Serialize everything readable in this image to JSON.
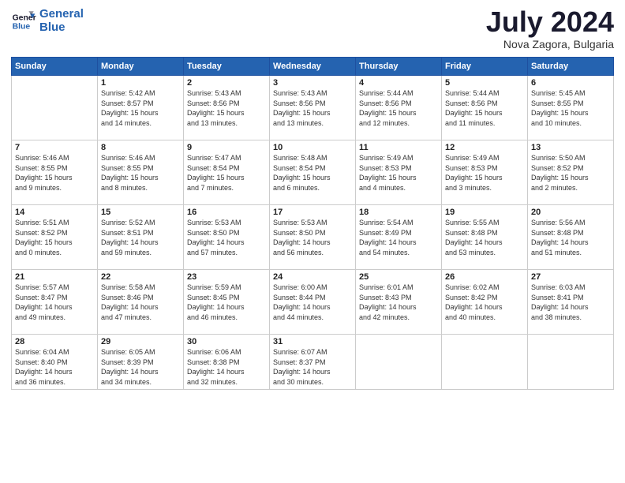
{
  "logo": {
    "line1": "General",
    "line2": "Blue"
  },
  "title": "July 2024",
  "location": "Nova Zagora, Bulgaria",
  "days_header": [
    "Sunday",
    "Monday",
    "Tuesday",
    "Wednesday",
    "Thursday",
    "Friday",
    "Saturday"
  ],
  "weeks": [
    [
      {
        "day": "",
        "info": ""
      },
      {
        "day": "1",
        "info": "Sunrise: 5:42 AM\nSunset: 8:57 PM\nDaylight: 15 hours\nand 14 minutes."
      },
      {
        "day": "2",
        "info": "Sunrise: 5:43 AM\nSunset: 8:56 PM\nDaylight: 15 hours\nand 13 minutes."
      },
      {
        "day": "3",
        "info": "Sunrise: 5:43 AM\nSunset: 8:56 PM\nDaylight: 15 hours\nand 13 minutes."
      },
      {
        "day": "4",
        "info": "Sunrise: 5:44 AM\nSunset: 8:56 PM\nDaylight: 15 hours\nand 12 minutes."
      },
      {
        "day": "5",
        "info": "Sunrise: 5:44 AM\nSunset: 8:56 PM\nDaylight: 15 hours\nand 11 minutes."
      },
      {
        "day": "6",
        "info": "Sunrise: 5:45 AM\nSunset: 8:55 PM\nDaylight: 15 hours\nand 10 minutes."
      }
    ],
    [
      {
        "day": "7",
        "info": "Sunrise: 5:46 AM\nSunset: 8:55 PM\nDaylight: 15 hours\nand 9 minutes."
      },
      {
        "day": "8",
        "info": "Sunrise: 5:46 AM\nSunset: 8:55 PM\nDaylight: 15 hours\nand 8 minutes."
      },
      {
        "day": "9",
        "info": "Sunrise: 5:47 AM\nSunset: 8:54 PM\nDaylight: 15 hours\nand 7 minutes."
      },
      {
        "day": "10",
        "info": "Sunrise: 5:48 AM\nSunset: 8:54 PM\nDaylight: 15 hours\nand 6 minutes."
      },
      {
        "day": "11",
        "info": "Sunrise: 5:49 AM\nSunset: 8:53 PM\nDaylight: 15 hours\nand 4 minutes."
      },
      {
        "day": "12",
        "info": "Sunrise: 5:49 AM\nSunset: 8:53 PM\nDaylight: 15 hours\nand 3 minutes."
      },
      {
        "day": "13",
        "info": "Sunrise: 5:50 AM\nSunset: 8:52 PM\nDaylight: 15 hours\nand 2 minutes."
      }
    ],
    [
      {
        "day": "14",
        "info": "Sunrise: 5:51 AM\nSunset: 8:52 PM\nDaylight: 15 hours\nand 0 minutes."
      },
      {
        "day": "15",
        "info": "Sunrise: 5:52 AM\nSunset: 8:51 PM\nDaylight: 14 hours\nand 59 minutes."
      },
      {
        "day": "16",
        "info": "Sunrise: 5:53 AM\nSunset: 8:50 PM\nDaylight: 14 hours\nand 57 minutes."
      },
      {
        "day": "17",
        "info": "Sunrise: 5:53 AM\nSunset: 8:50 PM\nDaylight: 14 hours\nand 56 minutes."
      },
      {
        "day": "18",
        "info": "Sunrise: 5:54 AM\nSunset: 8:49 PM\nDaylight: 14 hours\nand 54 minutes."
      },
      {
        "day": "19",
        "info": "Sunrise: 5:55 AM\nSunset: 8:48 PM\nDaylight: 14 hours\nand 53 minutes."
      },
      {
        "day": "20",
        "info": "Sunrise: 5:56 AM\nSunset: 8:48 PM\nDaylight: 14 hours\nand 51 minutes."
      }
    ],
    [
      {
        "day": "21",
        "info": "Sunrise: 5:57 AM\nSunset: 8:47 PM\nDaylight: 14 hours\nand 49 minutes."
      },
      {
        "day": "22",
        "info": "Sunrise: 5:58 AM\nSunset: 8:46 PM\nDaylight: 14 hours\nand 47 minutes."
      },
      {
        "day": "23",
        "info": "Sunrise: 5:59 AM\nSunset: 8:45 PM\nDaylight: 14 hours\nand 46 minutes."
      },
      {
        "day": "24",
        "info": "Sunrise: 6:00 AM\nSunset: 8:44 PM\nDaylight: 14 hours\nand 44 minutes."
      },
      {
        "day": "25",
        "info": "Sunrise: 6:01 AM\nSunset: 8:43 PM\nDaylight: 14 hours\nand 42 minutes."
      },
      {
        "day": "26",
        "info": "Sunrise: 6:02 AM\nSunset: 8:42 PM\nDaylight: 14 hours\nand 40 minutes."
      },
      {
        "day": "27",
        "info": "Sunrise: 6:03 AM\nSunset: 8:41 PM\nDaylight: 14 hours\nand 38 minutes."
      }
    ],
    [
      {
        "day": "28",
        "info": "Sunrise: 6:04 AM\nSunset: 8:40 PM\nDaylight: 14 hours\nand 36 minutes."
      },
      {
        "day": "29",
        "info": "Sunrise: 6:05 AM\nSunset: 8:39 PM\nDaylight: 14 hours\nand 34 minutes."
      },
      {
        "day": "30",
        "info": "Sunrise: 6:06 AM\nSunset: 8:38 PM\nDaylight: 14 hours\nand 32 minutes."
      },
      {
        "day": "31",
        "info": "Sunrise: 6:07 AM\nSunset: 8:37 PM\nDaylight: 14 hours\nand 30 minutes."
      },
      {
        "day": "",
        "info": ""
      },
      {
        "day": "",
        "info": ""
      },
      {
        "day": "",
        "info": ""
      }
    ]
  ]
}
